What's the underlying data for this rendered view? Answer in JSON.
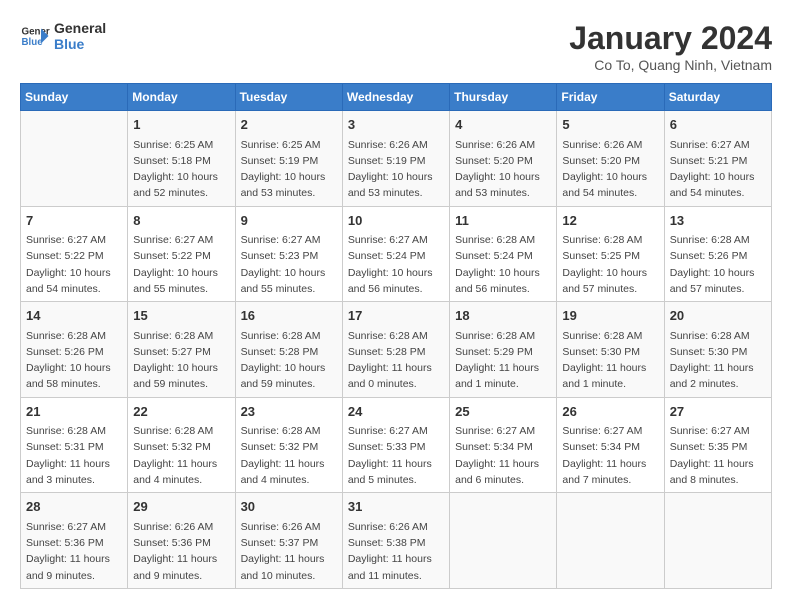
{
  "header": {
    "logo_line1": "General",
    "logo_line2": "Blue",
    "month": "January 2024",
    "location": "Co To, Quang Ninh, Vietnam"
  },
  "weekdays": [
    "Sunday",
    "Monday",
    "Tuesday",
    "Wednesday",
    "Thursday",
    "Friday",
    "Saturday"
  ],
  "weeks": [
    [
      {
        "day": "",
        "lines": []
      },
      {
        "day": "1",
        "lines": [
          "Sunrise: 6:25 AM",
          "Sunset: 5:18 PM",
          "Daylight: 10 hours",
          "and 52 minutes."
        ]
      },
      {
        "day": "2",
        "lines": [
          "Sunrise: 6:25 AM",
          "Sunset: 5:19 PM",
          "Daylight: 10 hours",
          "and 53 minutes."
        ]
      },
      {
        "day": "3",
        "lines": [
          "Sunrise: 6:26 AM",
          "Sunset: 5:19 PM",
          "Daylight: 10 hours",
          "and 53 minutes."
        ]
      },
      {
        "day": "4",
        "lines": [
          "Sunrise: 6:26 AM",
          "Sunset: 5:20 PM",
          "Daylight: 10 hours",
          "and 53 minutes."
        ]
      },
      {
        "day": "5",
        "lines": [
          "Sunrise: 6:26 AM",
          "Sunset: 5:20 PM",
          "Daylight: 10 hours",
          "and 54 minutes."
        ]
      },
      {
        "day": "6",
        "lines": [
          "Sunrise: 6:27 AM",
          "Sunset: 5:21 PM",
          "Daylight: 10 hours",
          "and 54 minutes."
        ]
      }
    ],
    [
      {
        "day": "7",
        "lines": [
          "Sunrise: 6:27 AM",
          "Sunset: 5:22 PM",
          "Daylight: 10 hours",
          "and 54 minutes."
        ]
      },
      {
        "day": "8",
        "lines": [
          "Sunrise: 6:27 AM",
          "Sunset: 5:22 PM",
          "Daylight: 10 hours",
          "and 55 minutes."
        ]
      },
      {
        "day": "9",
        "lines": [
          "Sunrise: 6:27 AM",
          "Sunset: 5:23 PM",
          "Daylight: 10 hours",
          "and 55 minutes."
        ]
      },
      {
        "day": "10",
        "lines": [
          "Sunrise: 6:27 AM",
          "Sunset: 5:24 PM",
          "Daylight: 10 hours",
          "and 56 minutes."
        ]
      },
      {
        "day": "11",
        "lines": [
          "Sunrise: 6:28 AM",
          "Sunset: 5:24 PM",
          "Daylight: 10 hours",
          "and 56 minutes."
        ]
      },
      {
        "day": "12",
        "lines": [
          "Sunrise: 6:28 AM",
          "Sunset: 5:25 PM",
          "Daylight: 10 hours",
          "and 57 minutes."
        ]
      },
      {
        "day": "13",
        "lines": [
          "Sunrise: 6:28 AM",
          "Sunset: 5:26 PM",
          "Daylight: 10 hours",
          "and 57 minutes."
        ]
      }
    ],
    [
      {
        "day": "14",
        "lines": [
          "Sunrise: 6:28 AM",
          "Sunset: 5:26 PM",
          "Daylight: 10 hours",
          "and 58 minutes."
        ]
      },
      {
        "day": "15",
        "lines": [
          "Sunrise: 6:28 AM",
          "Sunset: 5:27 PM",
          "Daylight: 10 hours",
          "and 59 minutes."
        ]
      },
      {
        "day": "16",
        "lines": [
          "Sunrise: 6:28 AM",
          "Sunset: 5:28 PM",
          "Daylight: 10 hours",
          "and 59 minutes."
        ]
      },
      {
        "day": "17",
        "lines": [
          "Sunrise: 6:28 AM",
          "Sunset: 5:28 PM",
          "Daylight: 11 hours",
          "and 0 minutes."
        ]
      },
      {
        "day": "18",
        "lines": [
          "Sunrise: 6:28 AM",
          "Sunset: 5:29 PM",
          "Daylight: 11 hours",
          "and 1 minute."
        ]
      },
      {
        "day": "19",
        "lines": [
          "Sunrise: 6:28 AM",
          "Sunset: 5:30 PM",
          "Daylight: 11 hours",
          "and 1 minute."
        ]
      },
      {
        "day": "20",
        "lines": [
          "Sunrise: 6:28 AM",
          "Sunset: 5:30 PM",
          "Daylight: 11 hours",
          "and 2 minutes."
        ]
      }
    ],
    [
      {
        "day": "21",
        "lines": [
          "Sunrise: 6:28 AM",
          "Sunset: 5:31 PM",
          "Daylight: 11 hours",
          "and 3 minutes."
        ]
      },
      {
        "day": "22",
        "lines": [
          "Sunrise: 6:28 AM",
          "Sunset: 5:32 PM",
          "Daylight: 11 hours",
          "and 4 minutes."
        ]
      },
      {
        "day": "23",
        "lines": [
          "Sunrise: 6:28 AM",
          "Sunset: 5:32 PM",
          "Daylight: 11 hours",
          "and 4 minutes."
        ]
      },
      {
        "day": "24",
        "lines": [
          "Sunrise: 6:27 AM",
          "Sunset: 5:33 PM",
          "Daylight: 11 hours",
          "and 5 minutes."
        ]
      },
      {
        "day": "25",
        "lines": [
          "Sunrise: 6:27 AM",
          "Sunset: 5:34 PM",
          "Daylight: 11 hours",
          "and 6 minutes."
        ]
      },
      {
        "day": "26",
        "lines": [
          "Sunrise: 6:27 AM",
          "Sunset: 5:34 PM",
          "Daylight: 11 hours",
          "and 7 minutes."
        ]
      },
      {
        "day": "27",
        "lines": [
          "Sunrise: 6:27 AM",
          "Sunset: 5:35 PM",
          "Daylight: 11 hours",
          "and 8 minutes."
        ]
      }
    ],
    [
      {
        "day": "28",
        "lines": [
          "Sunrise: 6:27 AM",
          "Sunset: 5:36 PM",
          "Daylight: 11 hours",
          "and 9 minutes."
        ]
      },
      {
        "day": "29",
        "lines": [
          "Sunrise: 6:26 AM",
          "Sunset: 5:36 PM",
          "Daylight: 11 hours",
          "and 9 minutes."
        ]
      },
      {
        "day": "30",
        "lines": [
          "Sunrise: 6:26 AM",
          "Sunset: 5:37 PM",
          "Daylight: 11 hours",
          "and 10 minutes."
        ]
      },
      {
        "day": "31",
        "lines": [
          "Sunrise: 6:26 AM",
          "Sunset: 5:38 PM",
          "Daylight: 11 hours",
          "and 11 minutes."
        ]
      },
      {
        "day": "",
        "lines": []
      },
      {
        "day": "",
        "lines": []
      },
      {
        "day": "",
        "lines": []
      }
    ]
  ]
}
